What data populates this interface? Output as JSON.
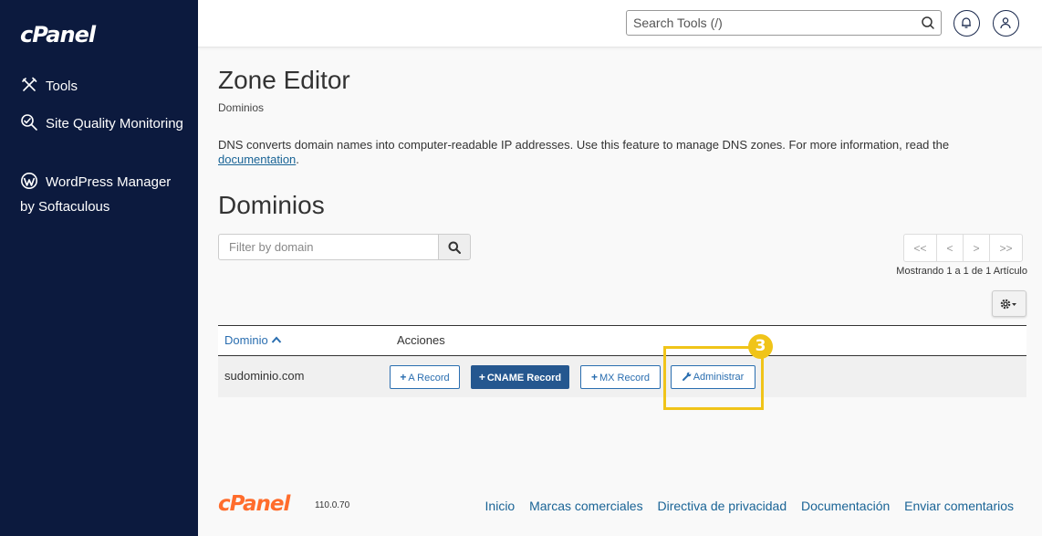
{
  "sidebar": {
    "brand": "cPanel",
    "items": [
      {
        "label": "Tools",
        "icon": "tools-icon"
      },
      {
        "label": "Site Quality Monitoring",
        "icon": "site-quality-icon"
      },
      {
        "label": "WordPress Manager by Softaculous",
        "icon": "wordpress-icon"
      }
    ]
  },
  "header": {
    "search_placeholder": "Search Tools (/)"
  },
  "main": {
    "title": "Zone Editor",
    "breadcrumb": "Dominios",
    "description_text": "DNS converts domain names into computer-readable IP addresses. Use this feature to manage DNS zones. For more information, read the ",
    "description_link": "documentation",
    "description_end": ".",
    "section_title": "Dominios",
    "filter_placeholder": "Filter by domain",
    "pager": {
      "first": "<<",
      "prev": "<",
      "next": ">",
      "last": ">>"
    },
    "showing": "Mostrando 1 a 1 de 1 Artículo"
  },
  "table": {
    "headers": {
      "domain": "Dominio",
      "actions": "Acciones"
    },
    "rows": [
      {
        "domain": "sudominio.com",
        "actions": {
          "a_record": "A Record",
          "cname_record": "CNAME Record",
          "mx_record": "MX Record",
          "manage": "Administrar"
        }
      }
    ]
  },
  "annotation": {
    "step": "3",
    "color": "#f0c419"
  },
  "footer": {
    "brand": "cPanel",
    "version": "110.0.70",
    "links": [
      "Inicio",
      "Marcas comerciales",
      "Directiva de privacidad",
      "Documentación",
      "Enviar comentarios"
    ]
  },
  "colors": {
    "sidebar": "#0c1a3e",
    "link": "#1a6496",
    "primary": "#25578f",
    "footer_brand": "#ff6c2c"
  }
}
